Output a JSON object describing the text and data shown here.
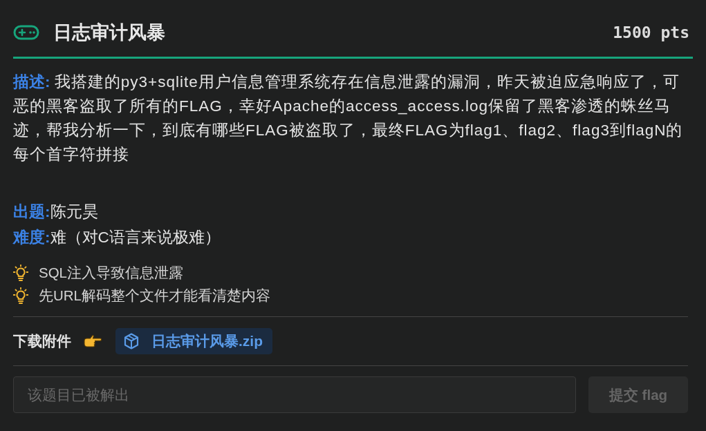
{
  "header": {
    "title": "日志审计风暴",
    "points": "1500 pts"
  },
  "description": {
    "label": "描述:",
    "text": "我搭建的py3+sqlite用户信息管理系统存在信息泄露的漏洞，昨天被迫应急响应了，可恶的黑客盗取了所有的FLAG，幸好Apache的access_access.log保留了黑客渗透的蛛丝马迹，帮我分析一下，到底有哪些FLAG被盗取了，最终FLAG为flag1、flag2、flag3到flagN的每个首字符拼接"
  },
  "meta": [
    {
      "label": "出题:",
      "value": "陈元昊"
    },
    {
      "label": "难度:",
      "value": "难（对C语言来说极难）"
    }
  ],
  "hints": [
    "SQL注入导致信息泄露",
    "先URL解码整个文件才能看清楚内容"
  ],
  "attachments": {
    "label": "下载附件",
    "files": [
      "日志审计风暴.zip"
    ]
  },
  "submit": {
    "placeholder": "该题目已被解出",
    "disabled": true,
    "button": {
      "label": "提交 flag",
      "disabled": true
    }
  }
}
